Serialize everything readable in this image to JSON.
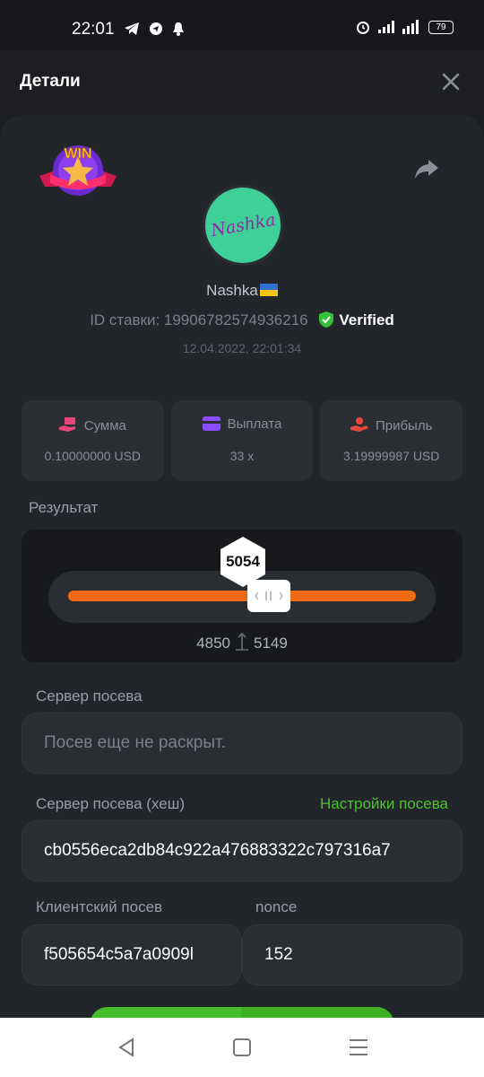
{
  "status_bar": {
    "time": "22:01",
    "battery": "79",
    "left_icons": [
      "telegram-icon",
      "navigation-icon",
      "bell-icon"
    ],
    "right_icons": [
      "alarm-icon",
      "signal-icon",
      "signal-icon",
      "battery-icon"
    ]
  },
  "header": {
    "title": "Детали",
    "close_icon": "close-icon"
  },
  "bet": {
    "badge_text": "WIN",
    "share_icon": "share-icon",
    "avatar_text": "Nashka",
    "username": "Nashka",
    "bet_id_label": "ID ставки: 19906782574936216",
    "verified_label": "Verified",
    "date": "12.04.2022, 22:01:34"
  },
  "stats": [
    {
      "icon": "money-hand-icon",
      "label": "Сумма",
      "value": "0.10000000 USD",
      "color": "#e8457a"
    },
    {
      "icon": "wallet-icon",
      "label": "Выплата",
      "value": "33 x",
      "color": "#8b4dff"
    },
    {
      "icon": "profit-hand-icon",
      "label": "Прибыль",
      "value": "3.19999987 USD",
      "color": "#e8473c"
    }
  ],
  "result": {
    "label": "Результат",
    "roll": "5054",
    "range_low": "4850",
    "range_high": "5149",
    "track_color": "#ef6a12"
  },
  "seed": {
    "server_label": "Сервер посева",
    "server_value": "Посев еще не раскрыт.",
    "hash_label": "Сервер посева (хеш)",
    "settings_link": "Настройки посева",
    "hash_value": "cb0556eca2db84c922a476883322c797316a7",
    "client_label": "Клиентский посев",
    "client_value": "f505654c5a7a0909l",
    "nonce_label": "nonce",
    "nonce_value": "152"
  },
  "colors": {
    "accent_green": "#48bd2b",
    "background": "#16181b"
  }
}
